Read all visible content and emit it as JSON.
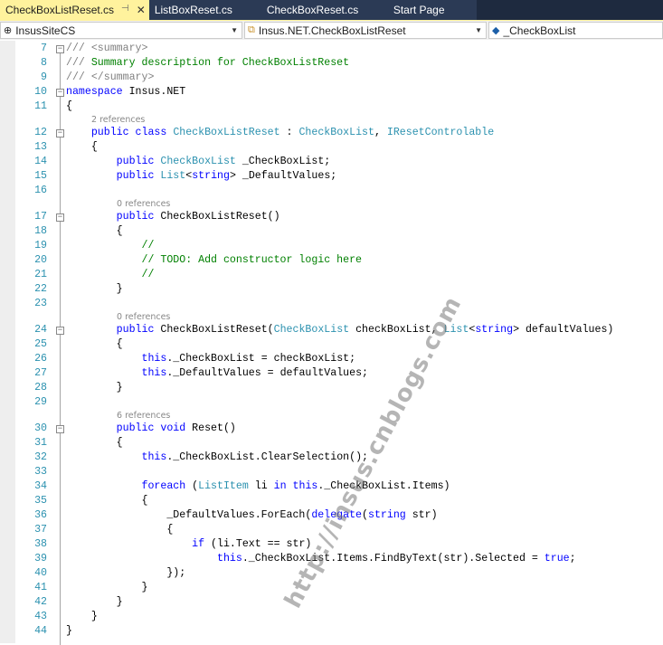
{
  "tabs": [
    {
      "label": "CheckBoxListReset.cs",
      "active": true,
      "pin": "⊣",
      "close": "✕"
    },
    {
      "label": "ListBoxReset.cs"
    },
    {
      "label": "CheckBoxReset.cs"
    },
    {
      "label": "Start Page"
    }
  ],
  "nav": {
    "project": "InsusSiteCS",
    "type": "Insus.NET.CheckBoxListReset",
    "member": "_CheckBoxList"
  },
  "watermark": "http://insus.cnblogs.com",
  "colors": {
    "keyword": "#0000ff",
    "type": "#2b91af",
    "comment": "#008000",
    "doc": "#808080",
    "active_tab": "#fff29d"
  },
  "lines": [
    {
      "n": "7",
      "fold": true,
      "tk": [
        [
          "g",
          "/// <summary>"
        ]
      ]
    },
    {
      "n": "8",
      "tk": [
        [
          "g",
          "///"
        ],
        [
          "c",
          " Summary description for CheckBoxListReset"
        ]
      ]
    },
    {
      "n": "9",
      "tk": [
        [
          "g",
          "/// </summary>"
        ]
      ]
    },
    {
      "n": "10",
      "fold": true,
      "tk": [
        [
          "k",
          "namespace"
        ],
        [
          "p",
          " Insus.NET"
        ]
      ]
    },
    {
      "n": "11",
      "tk": [
        [
          "p",
          "{"
        ]
      ]
    },
    {
      "ref": "2 references",
      "indent": 4
    },
    {
      "n": "12",
      "fold": true,
      "tk": [
        [
          "p",
          "    "
        ],
        [
          "k",
          "public class"
        ],
        [
          "p",
          " "
        ],
        [
          "t",
          "CheckBoxListReset"
        ],
        [
          "p",
          " : "
        ],
        [
          "t",
          "CheckBoxList"
        ],
        [
          "p",
          ", "
        ],
        [
          "t",
          "IResetControlable"
        ]
      ]
    },
    {
      "n": "13",
      "tk": [
        [
          "p",
          "    {"
        ]
      ]
    },
    {
      "n": "14",
      "tk": [
        [
          "p",
          "        "
        ],
        [
          "k",
          "public"
        ],
        [
          "p",
          " "
        ],
        [
          "t",
          "CheckBoxList"
        ],
        [
          "p",
          " _CheckBoxList;"
        ]
      ]
    },
    {
      "n": "15",
      "tk": [
        [
          "p",
          "        "
        ],
        [
          "k",
          "public"
        ],
        [
          "p",
          " "
        ],
        [
          "t",
          "List"
        ],
        [
          "p",
          "<"
        ],
        [
          "k",
          "string"
        ],
        [
          "p",
          "> _DefaultValues;"
        ]
      ]
    },
    {
      "n": "16",
      "tk": []
    },
    {
      "ref": "0 references",
      "indent": 8
    },
    {
      "n": "17",
      "fold": true,
      "tk": [
        [
          "p",
          "        "
        ],
        [
          "k",
          "public"
        ],
        [
          "p",
          " CheckBoxListReset()"
        ]
      ]
    },
    {
      "n": "18",
      "tk": [
        [
          "p",
          "        {"
        ]
      ]
    },
    {
      "n": "19",
      "tk": [
        [
          "p",
          "            "
        ],
        [
          "c",
          "//"
        ]
      ]
    },
    {
      "n": "20",
      "tk": [
        [
          "p",
          "            "
        ],
        [
          "c",
          "// TODO: Add constructor logic here"
        ]
      ]
    },
    {
      "n": "21",
      "tk": [
        [
          "p",
          "            "
        ],
        [
          "c",
          "//"
        ]
      ]
    },
    {
      "n": "22",
      "tk": [
        [
          "p",
          "        }"
        ]
      ]
    },
    {
      "n": "23",
      "tk": []
    },
    {
      "ref": "0 references",
      "indent": 8
    },
    {
      "n": "24",
      "fold": true,
      "tk": [
        [
          "p",
          "        "
        ],
        [
          "k",
          "public"
        ],
        [
          "p",
          " CheckBoxListReset("
        ],
        [
          "t",
          "CheckBoxList"
        ],
        [
          "p",
          " checkBoxList, "
        ],
        [
          "t",
          "List"
        ],
        [
          "p",
          "<"
        ],
        [
          "k",
          "string"
        ],
        [
          "p",
          "> defaultValues)"
        ]
      ]
    },
    {
      "n": "25",
      "tk": [
        [
          "p",
          "        {"
        ]
      ]
    },
    {
      "n": "26",
      "tk": [
        [
          "p",
          "            "
        ],
        [
          "k",
          "this"
        ],
        [
          "p",
          "._CheckBoxList = checkBoxList;"
        ]
      ]
    },
    {
      "n": "27",
      "tk": [
        [
          "p",
          "            "
        ],
        [
          "k",
          "this"
        ],
        [
          "p",
          "._DefaultValues = defaultValues;"
        ]
      ]
    },
    {
      "n": "28",
      "tk": [
        [
          "p",
          "        }"
        ]
      ]
    },
    {
      "n": "29",
      "tk": []
    },
    {
      "ref": "6 references",
      "indent": 8
    },
    {
      "n": "30",
      "fold": true,
      "tk": [
        [
          "p",
          "        "
        ],
        [
          "k",
          "public void"
        ],
        [
          "p",
          " Reset()"
        ]
      ]
    },
    {
      "n": "31",
      "tk": [
        [
          "p",
          "        {"
        ]
      ]
    },
    {
      "n": "32",
      "tk": [
        [
          "p",
          "            "
        ],
        [
          "k",
          "this"
        ],
        [
          "p",
          "._CheckBoxList.ClearSelection();"
        ]
      ]
    },
    {
      "n": "33",
      "tk": []
    },
    {
      "n": "34",
      "tk": [
        [
          "p",
          "            "
        ],
        [
          "k",
          "foreach"
        ],
        [
          "p",
          " ("
        ],
        [
          "t",
          "ListItem"
        ],
        [
          "p",
          " li "
        ],
        [
          "k",
          "in"
        ],
        [
          "p",
          " "
        ],
        [
          "k",
          "this"
        ],
        [
          "p",
          "._CheckBoxList.Items)"
        ]
      ]
    },
    {
      "n": "35",
      "tk": [
        [
          "p",
          "            {"
        ]
      ]
    },
    {
      "n": "36",
      "tk": [
        [
          "p",
          "                _DefaultValues.ForEach("
        ],
        [
          "k",
          "delegate"
        ],
        [
          "p",
          "("
        ],
        [
          "k",
          "string"
        ],
        [
          "p",
          " str)"
        ]
      ]
    },
    {
      "n": "37",
      "tk": [
        [
          "p",
          "                {"
        ]
      ]
    },
    {
      "n": "38",
      "tk": [
        [
          "p",
          "                    "
        ],
        [
          "k",
          "if"
        ],
        [
          "p",
          " (li.Text == str)"
        ]
      ]
    },
    {
      "n": "39",
      "tk": [
        [
          "p",
          "                        "
        ],
        [
          "k",
          "this"
        ],
        [
          "p",
          "._CheckBoxList.Items.FindByText(str).Selected = "
        ],
        [
          "k",
          "true"
        ],
        [
          "p",
          ";"
        ]
      ]
    },
    {
      "n": "40",
      "tk": [
        [
          "p",
          "                });"
        ]
      ]
    },
    {
      "n": "41",
      "tk": [
        [
          "p",
          "            }"
        ]
      ]
    },
    {
      "n": "42",
      "tk": [
        [
          "p",
          "        }"
        ]
      ]
    },
    {
      "n": "43",
      "tk": [
        [
          "p",
          "    }"
        ]
      ]
    },
    {
      "n": "44",
      "tk": [
        [
          "p",
          "}"
        ]
      ]
    }
  ]
}
